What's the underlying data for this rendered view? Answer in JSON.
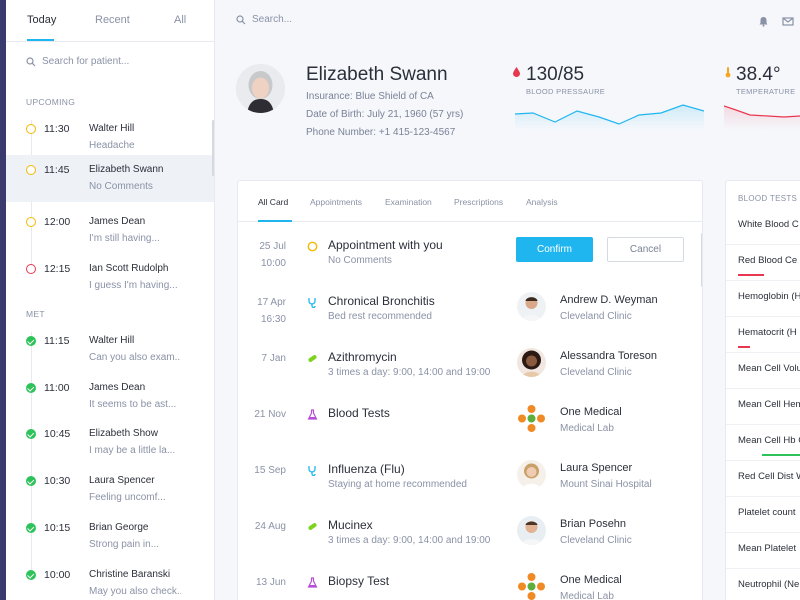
{
  "sidebar": {
    "tabs": [
      {
        "label": "Today",
        "active": true
      },
      {
        "label": "Recent",
        "active": false
      },
      {
        "label": "All",
        "active": false
      }
    ],
    "search_placeholder": "Search for patient...",
    "upcoming_label": "UPCOMING",
    "met_label": "MET",
    "upcoming": [
      {
        "time": "11:30",
        "name": "Walter Hill",
        "note": "Headache",
        "status": "pending"
      },
      {
        "time": "11:45",
        "name": "Elizabeth Swann",
        "note": "No Comments",
        "status": "pending",
        "selected": true
      },
      {
        "time": "12:00",
        "name": "James Dean",
        "note": "I'm still having...",
        "status": "pending"
      },
      {
        "time": "12:15",
        "name": "Ian Scott Rudolph",
        "note": "I guess I'm having...",
        "status": "urgent"
      }
    ],
    "met": [
      {
        "time": "11:15",
        "name": "Walter Hill",
        "note": "Can you also exam..."
      },
      {
        "time": "11:00",
        "name": "James Dean",
        "note": "It seems to be ast..."
      },
      {
        "time": "10:45",
        "name": "Elizabeth Show",
        "note": "I may be a little la..."
      },
      {
        "time": "10:30",
        "name": "Laura Spencer",
        "note": "Feeling uncomf..."
      },
      {
        "time": "10:15",
        "name": "Brian George",
        "note": "Strong pain in..."
      },
      {
        "time": "10:00",
        "name": "Christine Baranski",
        "note": "May you also check..."
      }
    ]
  },
  "topbar": {
    "search_placeholder": "Search...",
    "icons": [
      "bell-icon",
      "mail-icon"
    ]
  },
  "patient": {
    "name": "Elizabeth Swann",
    "insurance": "Insurance: Blue Shield of CA",
    "dob": "Date of Birth: July 21, 1960 (57 yrs)",
    "phone": "Phone Number: +1 415-123-4567"
  },
  "vitals": [
    {
      "value": "130/85",
      "label": "BLOOD PRESSAURE",
      "color": "#1fb6f0",
      "icon": "drop-icon"
    },
    {
      "value": "38.4°",
      "label": "TEMPERATURE",
      "color": "#e8384f",
      "icon": "thermometer-icon"
    }
  ],
  "card": {
    "tabs": [
      {
        "label": "All Card",
        "active": true
      },
      {
        "label": "Appointments",
        "active": false
      },
      {
        "label": "Examination",
        "active": false
      },
      {
        "label": "Prescriptions",
        "active": false
      },
      {
        "label": "Analysis",
        "active": false
      }
    ],
    "confirm_label": "Confirm",
    "cancel_label": "Cancel",
    "rows": [
      {
        "date": "25 Jul",
        "time": "10:00",
        "icon": "appointment-icon",
        "title": "Appointment with you",
        "sub": "No Comments",
        "type": "appointment"
      },
      {
        "date": "17 Apr",
        "time": "16:30",
        "icon": "stethoscope-icon",
        "title": "Chronical Bronchitis",
        "sub": "Bed rest recommended",
        "doctor": "Andrew D. Weyman",
        "place": "Cleveland Clinic"
      },
      {
        "date": "7 Jan",
        "time": "",
        "icon": "pill-icon",
        "title": "Azithromycin",
        "sub": "3 times a day: 9:00, 14:00 and 19:00",
        "doctor": "Alessandra Toreson",
        "place": "Cleveland Clinic"
      },
      {
        "date": "21 Nov",
        "time": "",
        "icon": "flask-icon",
        "title": "Blood Tests",
        "sub": "",
        "doctor": "One Medical",
        "place": "Medical Lab"
      },
      {
        "date": "15 Sep",
        "time": "",
        "icon": "stethoscope-icon",
        "title": "Influenza (Flu)",
        "sub": "Staying at home recommended",
        "doctor": "Laura Spencer",
        "place": "Mount Sinai Hospital"
      },
      {
        "date": "24 Aug",
        "time": "",
        "icon": "pill-icon",
        "title": "Mucinex",
        "sub": "3 times a day: 9:00, 14:00 and 19:00",
        "doctor": "Brian Posehn",
        "place": "Cleveland Clinic"
      },
      {
        "date": "13 Jun",
        "time": "",
        "icon": "flask-icon",
        "title": "Biopsy Test",
        "sub": "",
        "doctor": "One Medical",
        "place": "Medical Lab"
      }
    ]
  },
  "blood_tests": {
    "title": "BLOOD TESTS",
    "items": [
      {
        "name": "White Blood C",
        "status": "none"
      },
      {
        "name": "Red Blood Ce",
        "status": "low",
        "color": "#e8384f"
      },
      {
        "name": "Hemoglobin (H",
        "status": "none"
      },
      {
        "name": "Hematocrit (H",
        "status": "low",
        "color": "#e8384f"
      },
      {
        "name": "Mean Cell Volu",
        "status": "none"
      },
      {
        "name": "Mean Cell Hem",
        "status": "none"
      },
      {
        "name": "Mean Cell Hb C",
        "status": "normal",
        "color": "#2ec35a"
      },
      {
        "name": "Red Cell Dist W",
        "status": "none"
      },
      {
        "name": "Platelet count",
        "status": "none"
      },
      {
        "name": "Mean Platelet",
        "status": "none"
      },
      {
        "name": "Neutrophil (Ne",
        "status": "none"
      }
    ]
  }
}
